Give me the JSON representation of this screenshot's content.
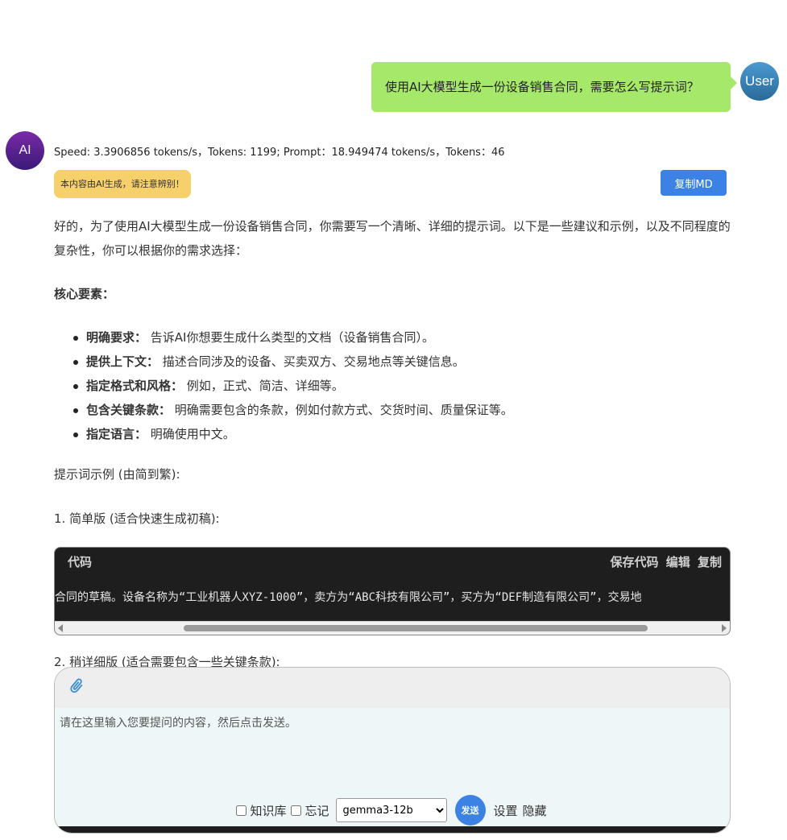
{
  "user_message": {
    "text": "使用AI大模型生成一份设备销售合同，需要怎么写提示词？",
    "avatar_label": "User"
  },
  "ai_message": {
    "avatar_label": "AI",
    "speed_info": "Speed: 3.3906856 tokens/s，Tokens: 1199; Prompt：18.949474 tokens/s，Tokens：46",
    "warning": "本内容由AI生成，请注意辨别！",
    "copy_md_label": "复制MD",
    "intro": "好的，为了使用AI大模型生成一份设备销售合同，你需要写一个清晰、详细的提示词。以下是一些建议和示例，以及不同程度的复杂性，你可以根据你的需求选择：",
    "core_heading": "核心要素：",
    "bullets": [
      {
        "bold": "明确要求：",
        "text": " 告诉AI你想要生成什么类型的文档（设备销售合同）。"
      },
      {
        "bold": "提供上下文：",
        "text": " 描述合同涉及的设备、买卖双方、交易地点等关键信息。"
      },
      {
        "bold": "指定格式和风格：",
        "text": " 例如，正式、简洁、详细等。"
      },
      {
        "bold": "包含关键条款：",
        "text": " 明确需要包含的条款，例如付款方式、交货时间、质量保证等。"
      },
      {
        "bold": "指定语言：",
        "text": " 明确使用中文。"
      }
    ],
    "examples_heading": "提示词示例 (由简到繁):",
    "example1_heading": "1. 简单版 (适合快速生成初稿):",
    "code_block": {
      "title": "代码",
      "save_label": "保存代码",
      "edit_label": "编辑",
      "copy_label": "复制",
      "code_line": "合同的草稿。设备名称为“工业机器人XYZ-1000”，卖方为“ABC科技有限公司”，买方为“DEF制造有限公司”，交易地"
    },
    "example2_heading": "2. 稍详细版 (适合需要包含一些关键条款):"
  },
  "input_panel": {
    "placeholder": "请在这里输入您要提问的内容，然后点击发送。",
    "knowledge_label": "知识库",
    "forget_label": "忘记",
    "model_selected": "gemma3-12b",
    "send_label": "发送",
    "settings_label": "设置",
    "hide_label": "隐藏"
  },
  "colors": {
    "user_bubble": "#a6e86a",
    "accent": "#3c82e4",
    "warning_bg": "#f6d06a",
    "code_bg": "#1e1e1e"
  }
}
